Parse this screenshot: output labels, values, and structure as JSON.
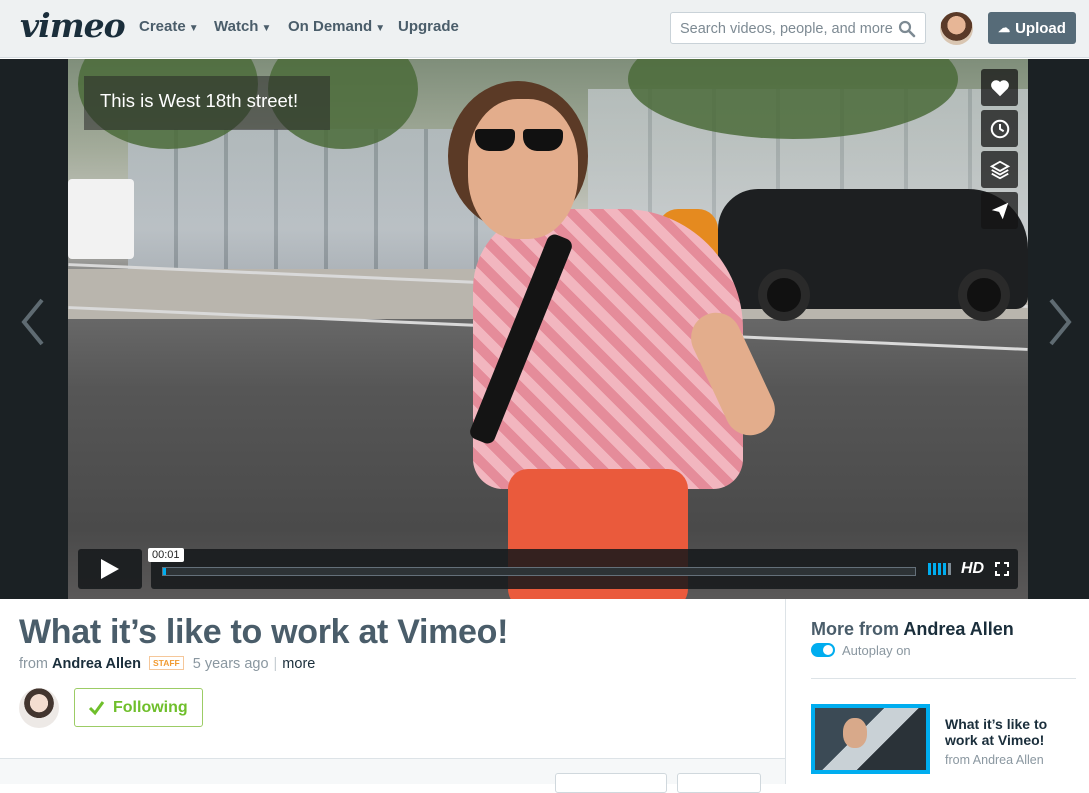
{
  "header": {
    "logo": "vimeo",
    "nav": [
      {
        "label": "Create",
        "dropdown": true
      },
      {
        "label": "Watch",
        "dropdown": true
      },
      {
        "label": "On Demand",
        "dropdown": true
      },
      {
        "label": "Upgrade",
        "dropdown": false
      }
    ],
    "search_placeholder": "Search videos, people, and more",
    "upload_label": "Upload"
  },
  "player": {
    "caption": "This is West 18th street!",
    "current_time": "00:01",
    "progress": 0.002,
    "quality": "HD",
    "side_actions": [
      "heart-icon",
      "clock-icon",
      "layers-icon",
      "send-icon"
    ],
    "accent": "#00adef"
  },
  "video": {
    "title": "What it’s like to work at Vimeo!",
    "from_label": "from",
    "author": "Andrea Allen",
    "badge": "STAFF",
    "age": "5 years ago",
    "more": "more",
    "follow_label": "Following",
    "follow_color": "#6fbf2b"
  },
  "sidebar": {
    "more_from_prefix": "More from",
    "more_from_name": "Andrea Allen",
    "autoplay_label": "Autoplay on",
    "autoplay_on": true,
    "recommended": [
      {
        "title": "What it’s like to work at Vimeo!",
        "from": "from Andrea Allen"
      }
    ]
  }
}
